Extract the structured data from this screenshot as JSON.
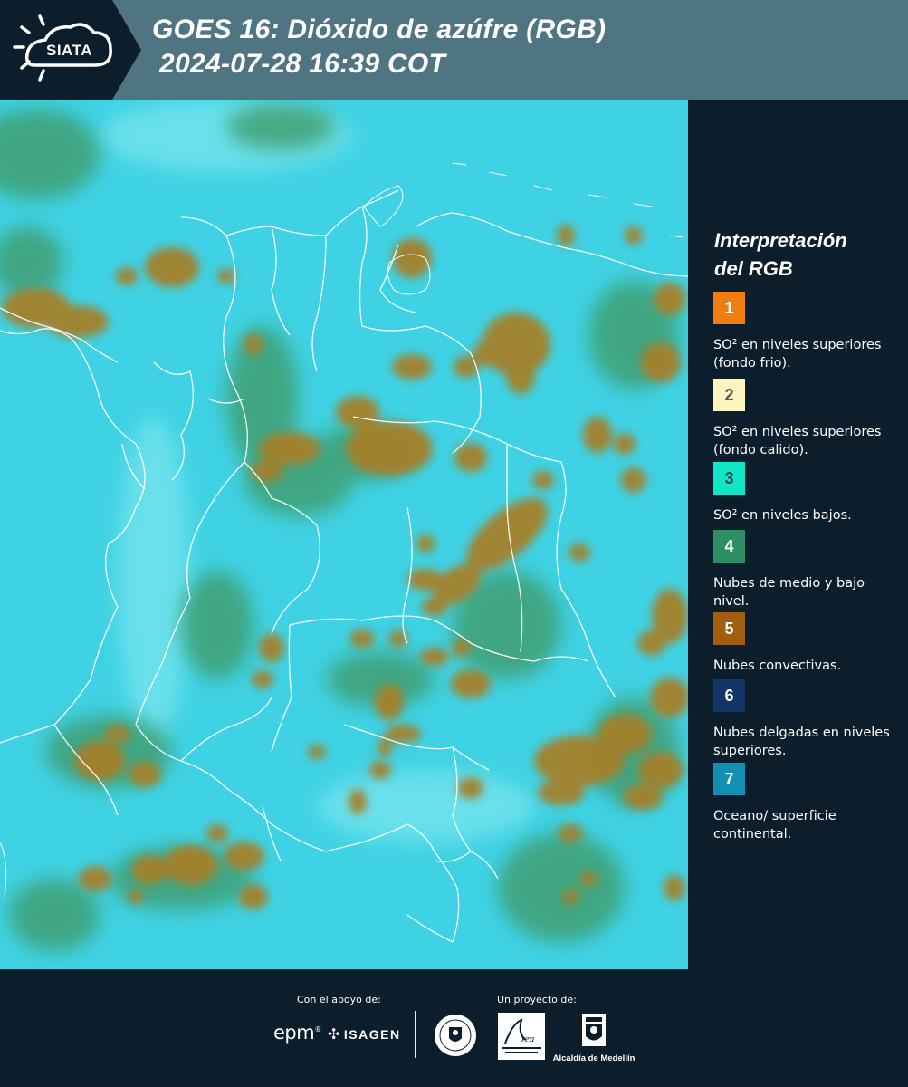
{
  "header": {
    "brand": "SIATA",
    "title_line1": "GOES 16: Dióxido de azúfre (RGB)",
    "title_line2": "2024-07-28 16:39 COT"
  },
  "legend": {
    "title": "Interpretación\ndel RGB",
    "items": [
      {
        "number": "1",
        "color": "#f27c0d",
        "number_color": "#ffffff",
        "text": "SO² en niveles superiores (fondo frio)."
      },
      {
        "number": "2",
        "color": "#fbf5bf",
        "number_color": "#555555",
        "text": "SO² en niveles superiores (fondo calido)."
      },
      {
        "number": "3",
        "color": "#10e6c7",
        "number_color": "#2c4650",
        "text": "SO² en niveles bajos."
      },
      {
        "number": "4",
        "color": "#2e8e63",
        "number_color": "#ffffff",
        "text": "Nubes de medio y bajo nivel."
      },
      {
        "number": "5",
        "color": "#a05e0e",
        "number_color": "#ffffff",
        "text": "Nubes convectivas."
      },
      {
        "number": "6",
        "color": "#143566",
        "number_color": "#ffffff",
        "text": "Nubes delgadas en niveles superiores."
      },
      {
        "number": "7",
        "color": "#148fb4",
        "number_color": "#ffffff",
        "text": "Oceano/ superficie continental."
      }
    ]
  },
  "map": {
    "background_color": "#3fd2e4",
    "cloud_color": "#a5802c",
    "low_cloud_color": "#3f9b6a",
    "border_color": "#ffffff"
  },
  "footer": {
    "support_label": "Con el apoyo de:",
    "project_label": "Un proyecto de:",
    "epm": "epm",
    "isagen": "ISAGEN",
    "alcaldia": "Alcaldía de Medellín"
  }
}
